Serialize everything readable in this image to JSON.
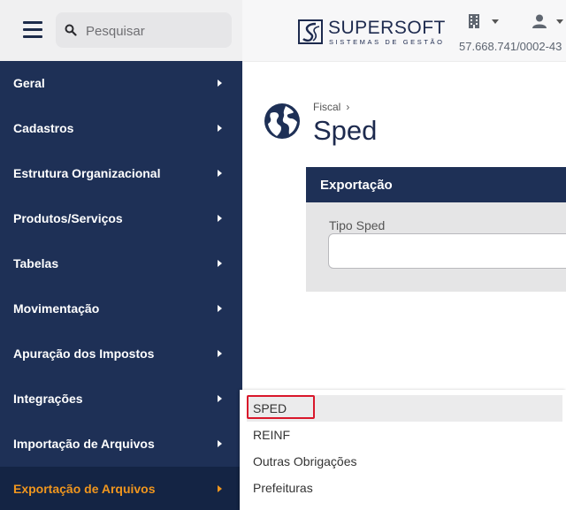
{
  "header": {
    "search_placeholder": "Pesquisar",
    "brand_name": "SUPERSOFT",
    "brand_tagline": "SISTEMAS DE GESTÃO",
    "cnpj": "57.668.741/0002-43",
    "icons": [
      "menu-icon",
      "search-icon",
      "building-icon",
      "user-icon"
    ]
  },
  "sidebar": {
    "items": [
      {
        "label": "Geral"
      },
      {
        "label": "Cadastros"
      },
      {
        "label": "Estrutura Organizacional"
      },
      {
        "label": "Produtos/Serviços"
      },
      {
        "label": "Tabelas"
      },
      {
        "label": "Movimentação"
      },
      {
        "label": "Apuração dos Impostos"
      },
      {
        "label": "Integrações"
      },
      {
        "label": "Importação de Arquivos"
      },
      {
        "label": "Exportação de Arquivos",
        "active": true
      }
    ]
  },
  "main": {
    "breadcrumb": "Fiscal",
    "breadcrumb_sep": "›",
    "title": "Sped",
    "panel_title": "Exportação",
    "field_label": "Tipo Sped"
  },
  "dropdown": {
    "items": [
      {
        "label": "SPED",
        "highlighted": true
      },
      {
        "label": "REINF"
      },
      {
        "label": "Outras Obrigações"
      },
      {
        "label": "Prefeituras"
      }
    ]
  },
  "colors": {
    "sidebar_bg": "#1e3056",
    "active_text": "#f0961e",
    "highlight_border": "#d9172b",
    "brand": "#1d2a4e"
  }
}
